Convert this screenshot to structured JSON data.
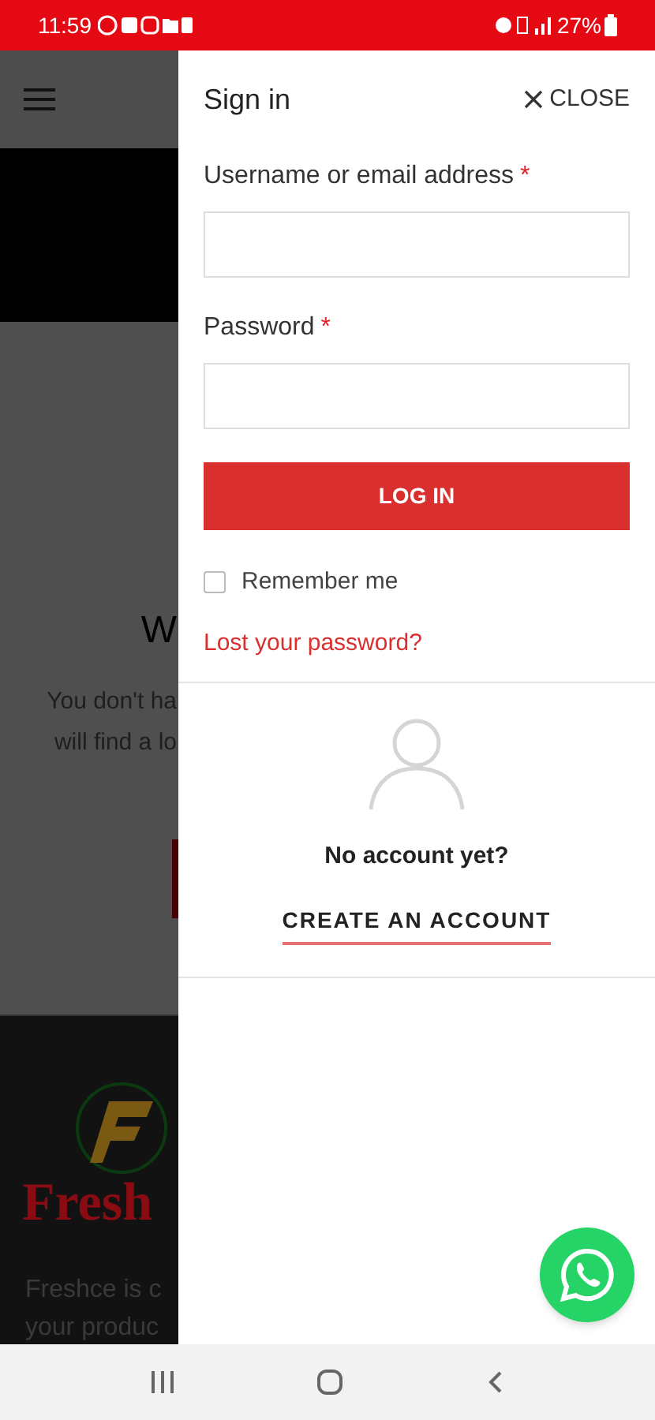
{
  "status_bar": {
    "time": "11:59",
    "battery": "27%"
  },
  "background_page": {
    "heading": "W",
    "text_lines": [
      "You don't ha",
      "will find a lo"
    ],
    "footer": {
      "logo_text": "Fresh",
      "text_lines": [
        "Freshce is c",
        "your produc"
      ]
    }
  },
  "drawer": {
    "title": "Sign in",
    "close": "CLOSE",
    "fields": [
      {
        "label": "Username or email address",
        "required_mark": "*"
      },
      {
        "label": "Password",
        "required_mark": "*"
      }
    ],
    "login_button": "LOG IN",
    "remember": {
      "label": "Remember me",
      "checked": false
    },
    "lost_password": "Lost your password?",
    "no_account": "No account yet?",
    "create_account": "CREATE AN ACCOUNT"
  }
}
